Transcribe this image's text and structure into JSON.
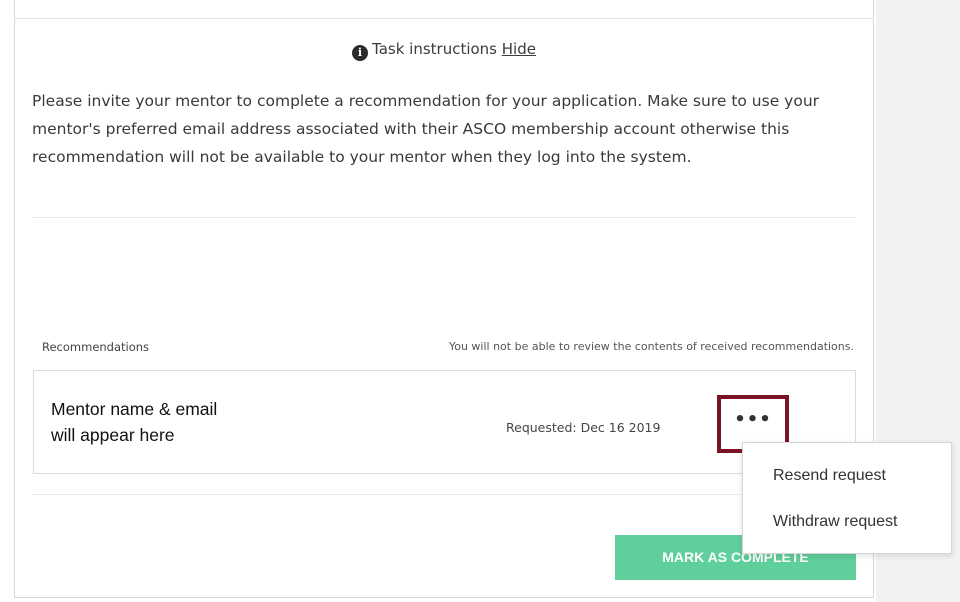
{
  "task": {
    "title": "Task instructions",
    "hide_label": "Hide",
    "info_icon": "i",
    "instructions": "Please invite your mentor to complete a recommendation for your application. Make sure to use your mentor's preferred email address associated with their ASCO membership account otherwise this recommendation will not be available to your mentor when they log into the system."
  },
  "recommendations": {
    "label": "Recommendations",
    "note": "You will not be able to review the contents of received recommendations.",
    "item": {
      "mentor_line1": "Mentor name & email",
      "mentor_line2": "will appear here",
      "requested": "Requested: Dec 16 2019",
      "more_icon": "•••"
    }
  },
  "menu": {
    "items": [
      "Resend request",
      "Withdraw request"
    ]
  },
  "actions": {
    "mark_complete": "MARK AS COMPLETE"
  },
  "colors": {
    "highlight_border": "#7a1424",
    "complete_button": "#5fcf9b"
  }
}
